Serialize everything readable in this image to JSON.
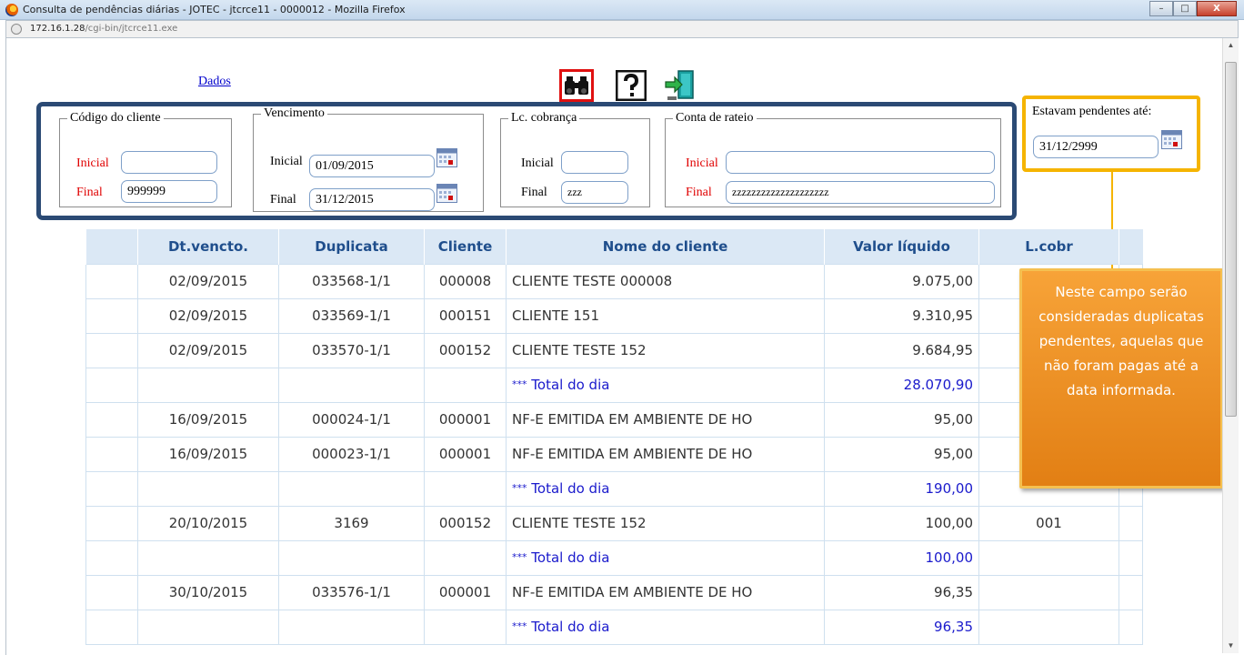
{
  "window": {
    "title": "Consulta de pendências diárias - JOTEC - jtcrce11 - 0000012 - Mozilla Firefox",
    "minimize": "–",
    "maximize": "□",
    "close": "X",
    "url_host": "172.16.1.28",
    "url_path": "/cgi-bin/jtcrce11.exe"
  },
  "toolbar": {
    "dados_link": "Dados",
    "icons": [
      "binoculars-icon",
      "help-icon",
      "exit-icon"
    ]
  },
  "filters": {
    "codigo_cliente": {
      "legend": "Código do cliente",
      "inicial_label": "Inicial",
      "inicial_value": "",
      "final_label": "Final",
      "final_value": "999999"
    },
    "vencimento": {
      "legend": "Vencimento",
      "inicial_label": "Inicial",
      "inicial_value": "01/09/2015",
      "final_label": "Final",
      "final_value": "31/12/2015"
    },
    "lc_cobranca": {
      "legend": "Lc. cobrança",
      "inicial_label": "Inicial",
      "inicial_value": "",
      "final_label": "Final",
      "final_value": "zzz"
    },
    "conta_rateio": {
      "legend": "Conta de rateio",
      "inicial_label": "Inicial",
      "inicial_value": "",
      "final_label": "Final",
      "final_value": "zzzzzzzzzzzzzzzzzzzz"
    },
    "estavam": {
      "label": "Estavam pendentes até:",
      "value": "31/12/2999"
    }
  },
  "table": {
    "headers": [
      "",
      "Dt.vencto.",
      "Duplicata",
      "Cliente",
      "Nome do cliente",
      "Valor líquido",
      "L.cobr",
      ""
    ],
    "rows": [
      {
        "type": "item",
        "date": "02/09/2015",
        "dup": "033568-1/1",
        "cli": "000008",
        "name": "CLIENTE TESTE 000008",
        "value": "9.075,00",
        "lcobr": ""
      },
      {
        "type": "item",
        "date": "02/09/2015",
        "dup": "033569-1/1",
        "cli": "000151",
        "name": "CLIENTE 151",
        "value": "9.310,95",
        "lcobr": ""
      },
      {
        "type": "item",
        "date": "02/09/2015",
        "dup": "033570-1/1",
        "cli": "000152",
        "name": "CLIENTE TESTE 152",
        "value": "9.684,95",
        "lcobr": ""
      },
      {
        "type": "total",
        "stars": "***",
        "name": "Total do dia",
        "value": "28.070,90"
      },
      {
        "type": "item",
        "date": "16/09/2015",
        "dup": "000024-1/1",
        "cli": "000001",
        "name": "NF-E EMITIDA EM AMBIENTE DE HO",
        "value": "95,00",
        "lcobr": ""
      },
      {
        "type": "item",
        "date": "16/09/2015",
        "dup": "000023-1/1",
        "cli": "000001",
        "name": "NF-E EMITIDA EM AMBIENTE DE HO",
        "value": "95,00",
        "lcobr": ""
      },
      {
        "type": "total",
        "stars": "***",
        "name": "Total do dia",
        "value": "190,00"
      },
      {
        "type": "item",
        "date": "20/10/2015",
        "dup": "3169",
        "cli": "000152",
        "name": "CLIENTE TESTE 152",
        "value": "100,00",
        "lcobr": "001"
      },
      {
        "type": "total",
        "stars": "***",
        "name": "Total do dia",
        "value": "100,00"
      },
      {
        "type": "item",
        "date": "30/10/2015",
        "dup": "033576-1/1",
        "cli": "000001",
        "name": "NF-E EMITIDA EM AMBIENTE DE HO",
        "value": "96,35",
        "lcobr": ""
      },
      {
        "type": "total",
        "stars": "***",
        "name": "Total do dia",
        "value": "96,35"
      }
    ]
  },
  "callout": {
    "text": "Neste campo serão consideradas duplicatas pendentes, aquelas que não foram pagas até a data informada."
  },
  "colors": {
    "panel_border": "#2b4a74",
    "highlight_border": "#f5b400",
    "search_border": "#e01010",
    "callout_bg": "#f29a2e",
    "header_bg": "#dbe8f5",
    "total_text": "#1a1acc"
  }
}
